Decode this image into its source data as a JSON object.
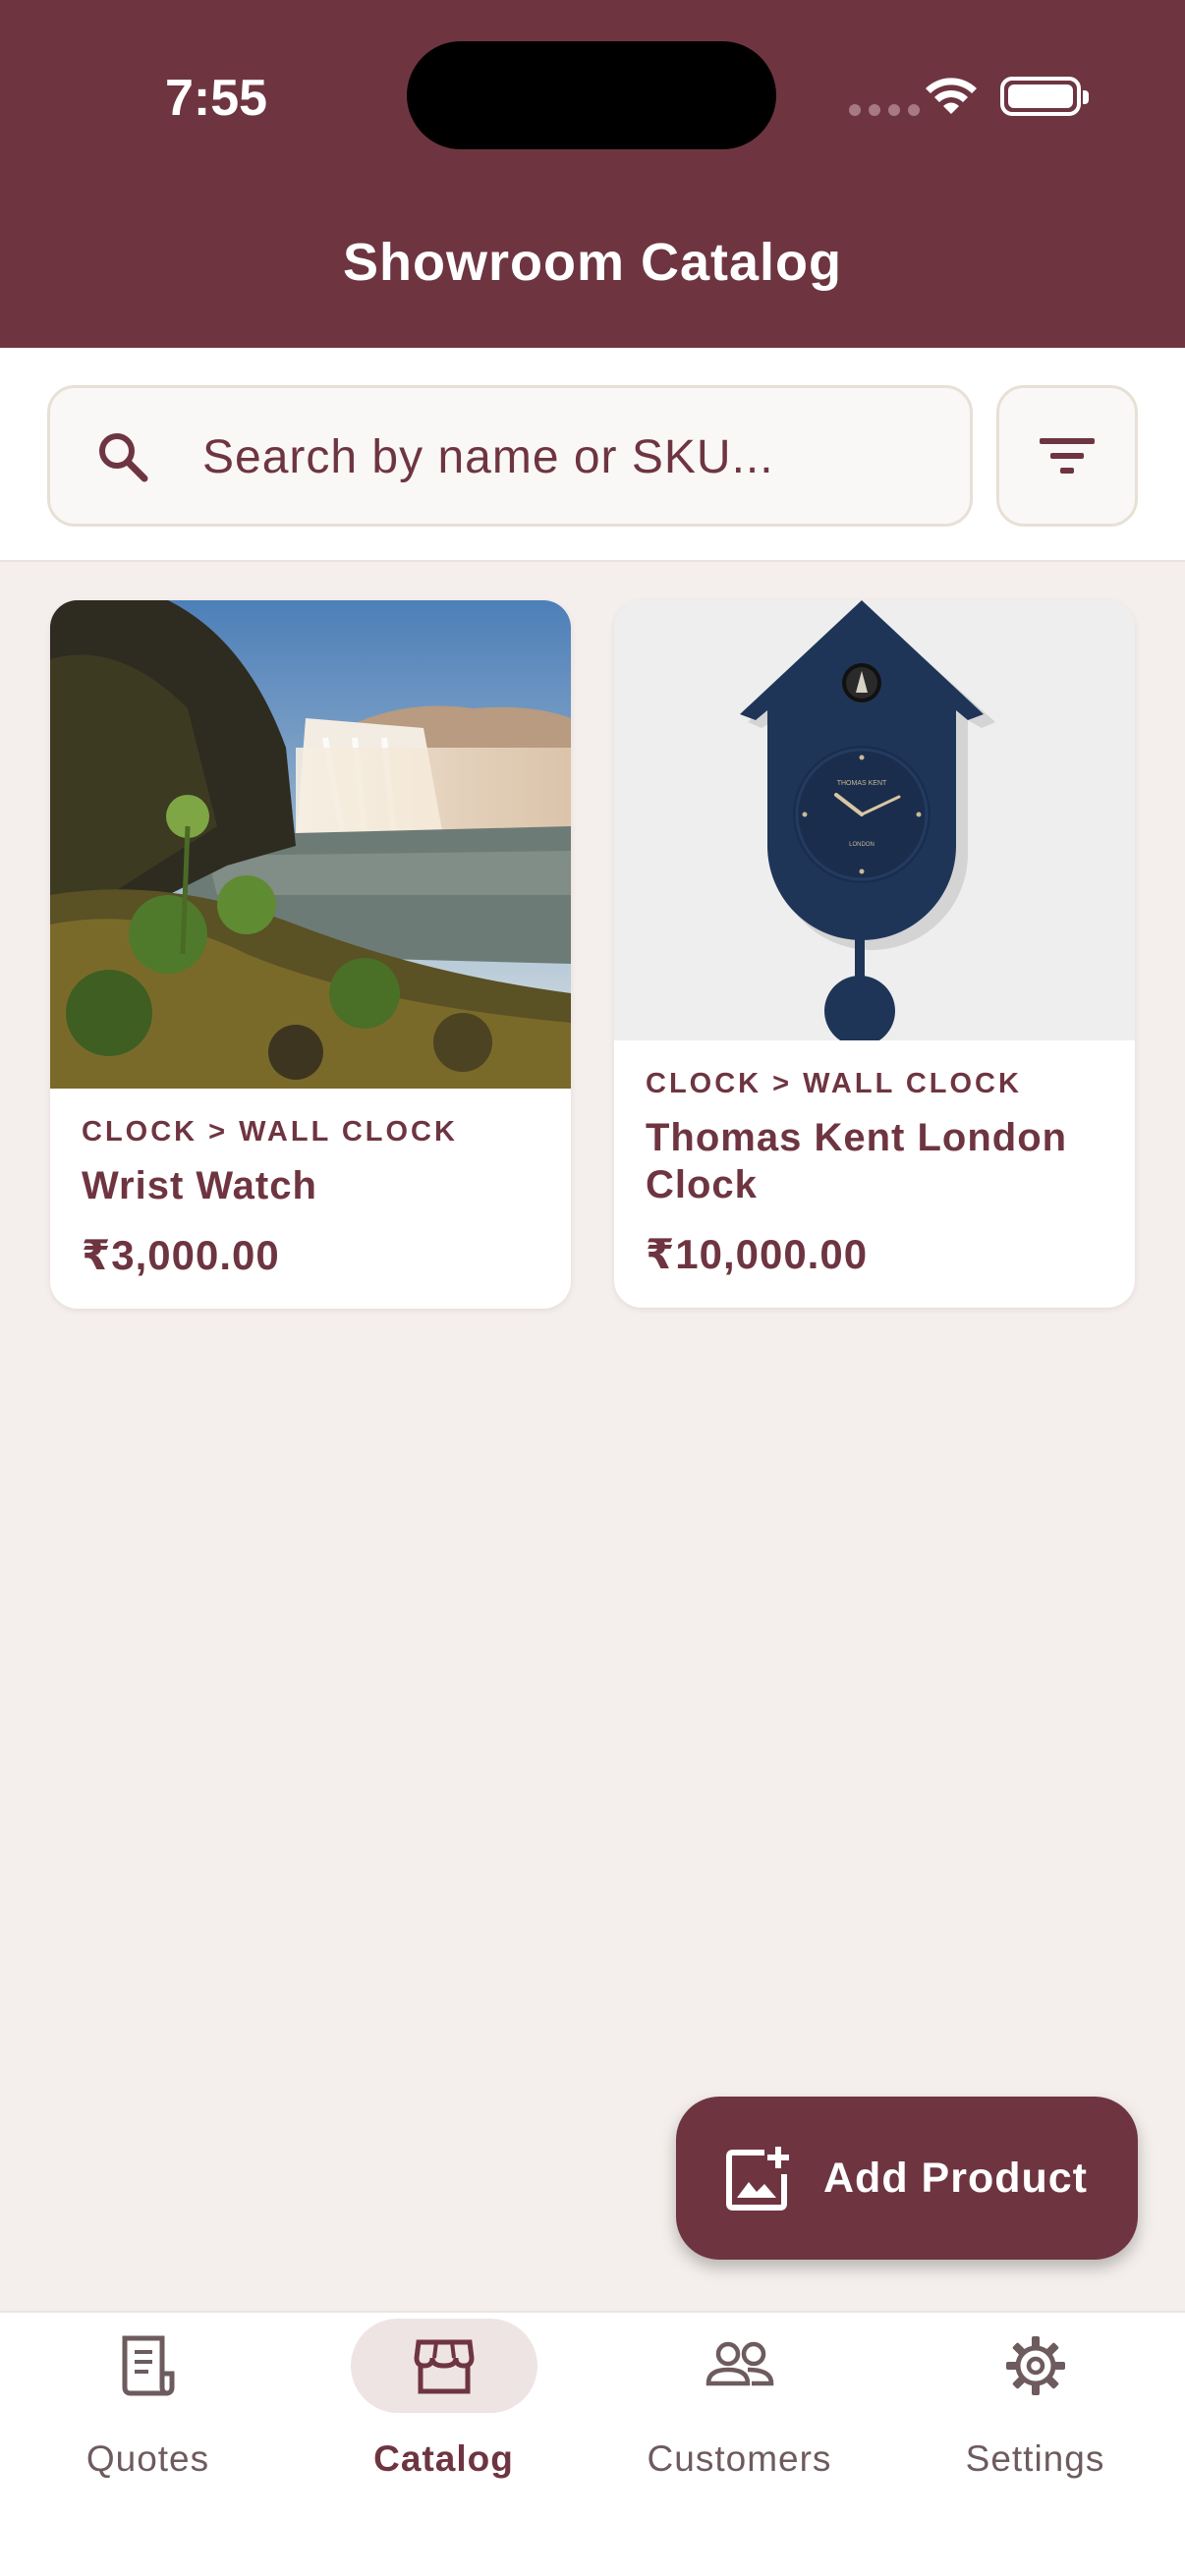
{
  "status_bar": {
    "time": "7:55"
  },
  "header": {
    "title": "Showroom Catalog"
  },
  "search": {
    "placeholder": "Search by name or SKU...",
    "value": ""
  },
  "products": [
    {
      "category": "CLOCK > WALL CLOCK",
      "name": "Wrist Watch",
      "price": "₹3,000.00",
      "image": "waterfall-landscape"
    },
    {
      "category": "CLOCK > WALL CLOCK",
      "name": "Thomas Kent London Clock",
      "price": "₹10,000.00",
      "image": "navy-cuckoo-clock",
      "clock_face_brand": "THOMAS KENT",
      "clock_face_city": "LONDON"
    }
  ],
  "fab": {
    "label": "Add Product",
    "icon": "add-photo-icon"
  },
  "bottom_nav": {
    "active": "Catalog",
    "items": [
      {
        "label": "Quotes",
        "icon": "receipt-icon"
      },
      {
        "label": "Catalog",
        "icon": "storefront-icon"
      },
      {
        "label": "Customers",
        "icon": "people-icon"
      },
      {
        "label": "Settings",
        "icon": "gear-icon"
      }
    ]
  },
  "colors": {
    "primary": "#6e3541",
    "background": "#f4efec",
    "surface": "#ffffff",
    "nav_active_pill": "#efe4e4"
  }
}
